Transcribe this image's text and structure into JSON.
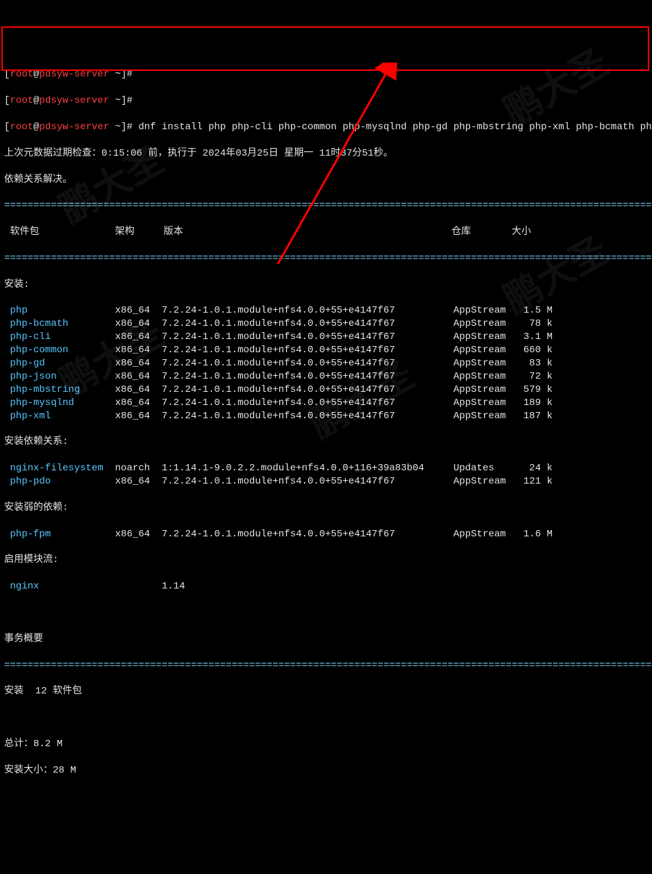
{
  "prompt": {
    "user": "root",
    "host": "pdsyw-server",
    "path": "~",
    "symbol": "#"
  },
  "blank_prompt_1": "[root@pdsyw-server ~]#",
  "blank_prompt_2": "[root@pdsyw-server ~]#",
  "command": "dnf install php php-cli php-common php-mysqlnd php-gd php-mbstring php-xml php-bcmath php-json -y",
  "meta_line": "上次元数据过期检查：0:15:06 前，执行于 2024年03月25日 星期一 11时37分51秒。",
  "resolve_line": "依赖关系解决。",
  "divider": "======================================================================================================================",
  "header": {
    "pkg": " 软件包",
    "arch": "架构",
    "ver": "版本",
    "repo": "仓库",
    "size": "大小"
  },
  "sections": {
    "install": "安装:",
    "deps": "安装依赖关系:",
    "weak": "安装弱的依赖:",
    "modules": "启用模块流:",
    "summary": "事务概要",
    "install_count": "安装  12 软件包",
    "total": "总计：8.2 M",
    "install_size": "安装大小：28 M"
  },
  "install_pkgs": [
    {
      "name": "php",
      "arch": "x86_64",
      "ver": "7.2.24-1.0.1.module+nfs4.0.0+55+e4147f67",
      "repo": "AppStream",
      "size": "1.5 M"
    },
    {
      "name": "php-bcmath",
      "arch": "x86_64",
      "ver": "7.2.24-1.0.1.module+nfs4.0.0+55+e4147f67",
      "repo": "AppStream",
      "size": "78 k"
    },
    {
      "name": "php-cli",
      "arch": "x86_64",
      "ver": "7.2.24-1.0.1.module+nfs4.0.0+55+e4147f67",
      "repo": "AppStream",
      "size": "3.1 M"
    },
    {
      "name": "php-common",
      "arch": "x86_64",
      "ver": "7.2.24-1.0.1.module+nfs4.0.0+55+e4147f67",
      "repo": "AppStream",
      "size": "660 k"
    },
    {
      "name": "php-gd",
      "arch": "x86_64",
      "ver": "7.2.24-1.0.1.module+nfs4.0.0+55+e4147f67",
      "repo": "AppStream",
      "size": "83 k"
    },
    {
      "name": "php-json",
      "arch": "x86_64",
      "ver": "7.2.24-1.0.1.module+nfs4.0.0+55+e4147f67",
      "repo": "AppStream",
      "size": "72 k"
    },
    {
      "name": "php-mbstring",
      "arch": "x86_64",
      "ver": "7.2.24-1.0.1.module+nfs4.0.0+55+e4147f67",
      "repo": "AppStream",
      "size": "579 k"
    },
    {
      "name": "php-mysqlnd",
      "arch": "x86_64",
      "ver": "7.2.24-1.0.1.module+nfs4.0.0+55+e4147f67",
      "repo": "AppStream",
      "size": "189 k"
    },
    {
      "name": "php-xml",
      "arch": "x86_64",
      "ver": "7.2.24-1.0.1.module+nfs4.0.0+55+e4147f67",
      "repo": "AppStream",
      "size": "187 k"
    }
  ],
  "dep_pkgs": [
    {
      "name": "nginx-filesystem",
      "arch": "noarch",
      "ver": "1:1.14.1-9.0.2.2.module+nfs4.0.0+116+39a83b04",
      "repo": "Updates",
      "size": "24 k"
    },
    {
      "name": "php-pdo",
      "arch": "x86_64",
      "ver": "7.2.24-1.0.1.module+nfs4.0.0+55+e4147f67",
      "repo": "AppStream",
      "size": "121 k"
    }
  ],
  "weak_pkgs": [
    {
      "name": "php-fpm",
      "arch": "x86_64",
      "ver": "7.2.24-1.0.1.module+nfs4.0.0+55+e4147f67",
      "repo": "AppStream",
      "size": "1.6 M"
    }
  ],
  "module_pkgs": [
    {
      "name": "nginx",
      "arch": "",
      "ver": "1.14",
      "repo": "",
      "size": ""
    }
  ],
  "watermark_text": "鹏大圣"
}
